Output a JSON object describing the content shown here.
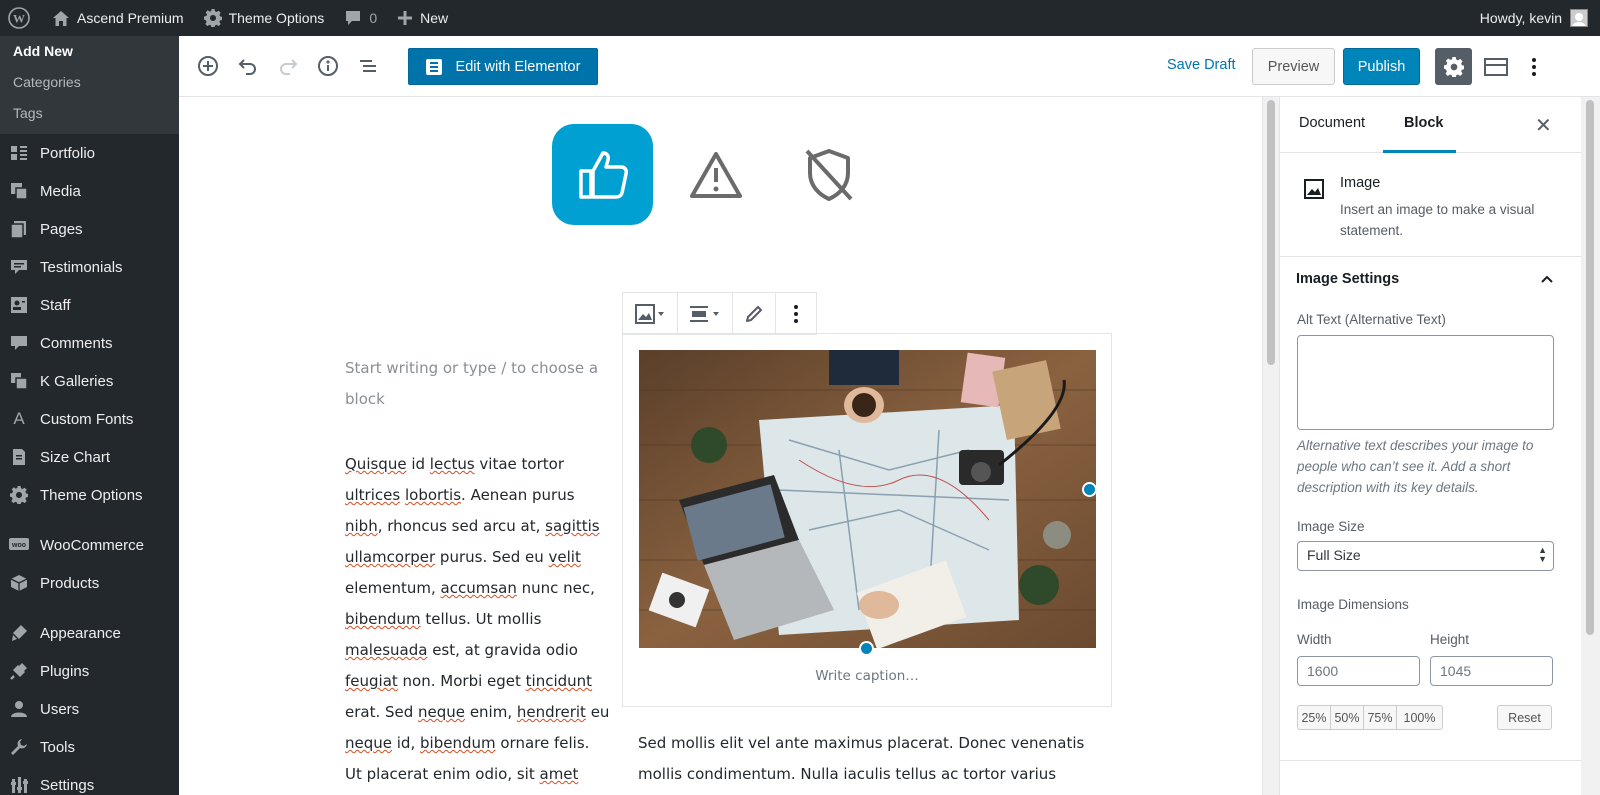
{
  "adminbar": {
    "site_name": "Ascend Premium",
    "theme_options": "Theme Options",
    "comments_count": "0",
    "new_label": "New",
    "greeting": "Howdy, kevin"
  },
  "sidebar": {
    "submenu": [
      "Add New",
      "Categories",
      "Tags"
    ],
    "items": [
      {
        "label": "Portfolio",
        "icon": "portfolio-icon"
      },
      {
        "label": "Media",
        "icon": "media-icon"
      },
      {
        "label": "Pages",
        "icon": "pages-icon"
      },
      {
        "label": "Testimonials",
        "icon": "testimonials-icon"
      },
      {
        "label": "Staff",
        "icon": "staff-icon"
      },
      {
        "label": "Comments",
        "icon": "comments-icon"
      },
      {
        "label": "K Galleries",
        "icon": "galleries-icon"
      },
      {
        "label": "Custom Fonts",
        "icon": "custom-fonts-icon"
      },
      {
        "label": "Size Chart",
        "icon": "size-chart-icon"
      },
      {
        "label": "Theme Options",
        "icon": "gear-icon"
      },
      {
        "label": "WooCommerce",
        "icon": "woocommerce-icon"
      },
      {
        "label": "Products",
        "icon": "products-icon"
      },
      {
        "label": "Appearance",
        "icon": "appearance-icon"
      },
      {
        "label": "Plugins",
        "icon": "plugins-icon"
      },
      {
        "label": "Users",
        "icon": "users-icon"
      },
      {
        "label": "Tools",
        "icon": "tools-icon"
      },
      {
        "label": "Settings",
        "icon": "settings-icon"
      }
    ]
  },
  "header": {
    "elementor_label": "Edit with Elementor",
    "save_draft": "Save Draft",
    "preview": "Preview",
    "publish": "Publish"
  },
  "canvas": {
    "placeholder": "Start writing or type / to choose a block",
    "caption_placeholder": "Write caption…",
    "para2_line1": "Sed mollis elit vel ante maximus placerat. Donec venenatis",
    "para2_line2": "mollis condimentum. Nulla iaculis tellus ac tortor varius"
  },
  "panel": {
    "tab_document": "Document",
    "tab_block": "Block",
    "block_title": "Image",
    "block_desc": "Insert an image to make a visual statement.",
    "section_title": "Image Settings",
    "alt_label": "Alt Text (Alternative Text)",
    "alt_help": "Alternative text describes your image to people who can’t see it. Add a short description with its key details.",
    "size_label": "Image Size",
    "size_value": "Full Size",
    "dims_label": "Image Dimensions",
    "width_label": "Width",
    "height_label": "Height",
    "width_value": "1600",
    "height_value": "1045",
    "pct": [
      "25%",
      "50%",
      "75%",
      "100%"
    ],
    "reset": "Reset"
  },
  "colors": {
    "accent": "#0085ba",
    "admin_dark": "#23282d",
    "thumb_tile": "#00a0d2"
  }
}
